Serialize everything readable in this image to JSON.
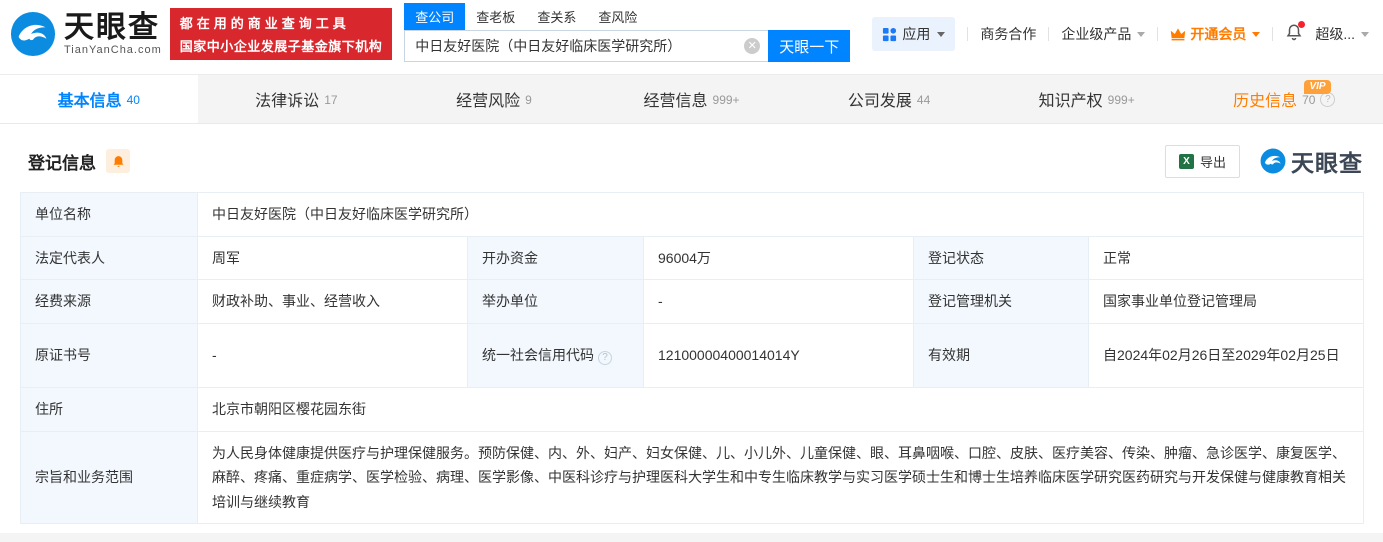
{
  "colors": {
    "accent_blue": "#0084ff",
    "banner_red": "#d9272e",
    "vip_orange": "#ff7c00",
    "history_orange": "#ff7e00",
    "excel_green": "#217346",
    "label_cell_bg": "#f2f8fd"
  },
  "header": {
    "logo": {
      "brand": "天眼查",
      "domain": "TianYanCha.com"
    },
    "banner": {
      "line1": "都在用的商业查询工具",
      "line2": "国家中小企业发展子基金旗下机构"
    },
    "search": {
      "tabs": [
        {
          "label": "查公司",
          "active": true
        },
        {
          "label": "查老板",
          "active": false
        },
        {
          "label": "查关系",
          "active": false
        },
        {
          "label": "查风险",
          "active": false
        }
      ],
      "value": "中日友好医院（中日友好临床医学研究所）",
      "button": "天眼一下"
    },
    "nav": {
      "apps": "应用",
      "biz": "商务合作",
      "enterprise": "企业级产品",
      "vip": "开通会员",
      "account": "超级..."
    }
  },
  "tabs": [
    {
      "label": "基本信息",
      "count": "40"
    },
    {
      "label": "法律诉讼",
      "count": "17"
    },
    {
      "label": "经营风险",
      "count": "9"
    },
    {
      "label": "经营信息",
      "count": "999+"
    },
    {
      "label": "公司发展",
      "count": "44"
    },
    {
      "label": "知识产权",
      "count": "999+"
    },
    {
      "label": "历史信息",
      "count": "70",
      "vip_badge": "VIP"
    }
  ],
  "section": {
    "title": "登记信息",
    "export_label": "导出",
    "watermark_brand": "天眼查"
  },
  "table": {
    "rows": [
      {
        "cells": [
          {
            "label": "单位名称",
            "value": "中日友好医院（中日友好临床医学研究所）"
          }
        ]
      },
      {
        "cells": [
          {
            "label": "法定代表人",
            "value": "周军"
          },
          {
            "label": "开办资金",
            "value": "96004万"
          },
          {
            "label": "登记状态",
            "value": "正常"
          }
        ]
      },
      {
        "cells": [
          {
            "label": "经费来源",
            "value": "财政补助、事业、经营收入"
          },
          {
            "label": "举办单位",
            "value": "-"
          },
          {
            "label": "登记管理机关",
            "value": "国家事业单位登记管理局"
          }
        ]
      },
      {
        "cells": [
          {
            "label": "原证书号",
            "value": "-"
          },
          {
            "label": "统一社会信用代码",
            "value": "12100000400014014Y"
          },
          {
            "label": "有效期",
            "value": "自2024年02月26日至2029年02月25日"
          }
        ]
      },
      {
        "cells": [
          {
            "label": "住所",
            "value": "北京市朝阳区樱花园东街"
          }
        ]
      },
      {
        "cells": [
          {
            "label": "宗旨和业务范围",
            "value": "为人民身体健康提供医疗与护理保健服务。预防保健、内、外、妇产、妇女保健、儿、小儿外、儿童保健、眼、耳鼻咽喉、口腔、皮肤、医疗美容、传染、肿瘤、急诊医学、康复医学、麻醉、疼痛、重症病学、医学检验、病理、医学影像、中医科诊疗与护理医科大学生和中专生临床教学与实习医学硕士生和博士生培养临床医学研究医药研究与开发保健与健康教育相关培训与继续教育"
          }
        ]
      }
    ]
  }
}
